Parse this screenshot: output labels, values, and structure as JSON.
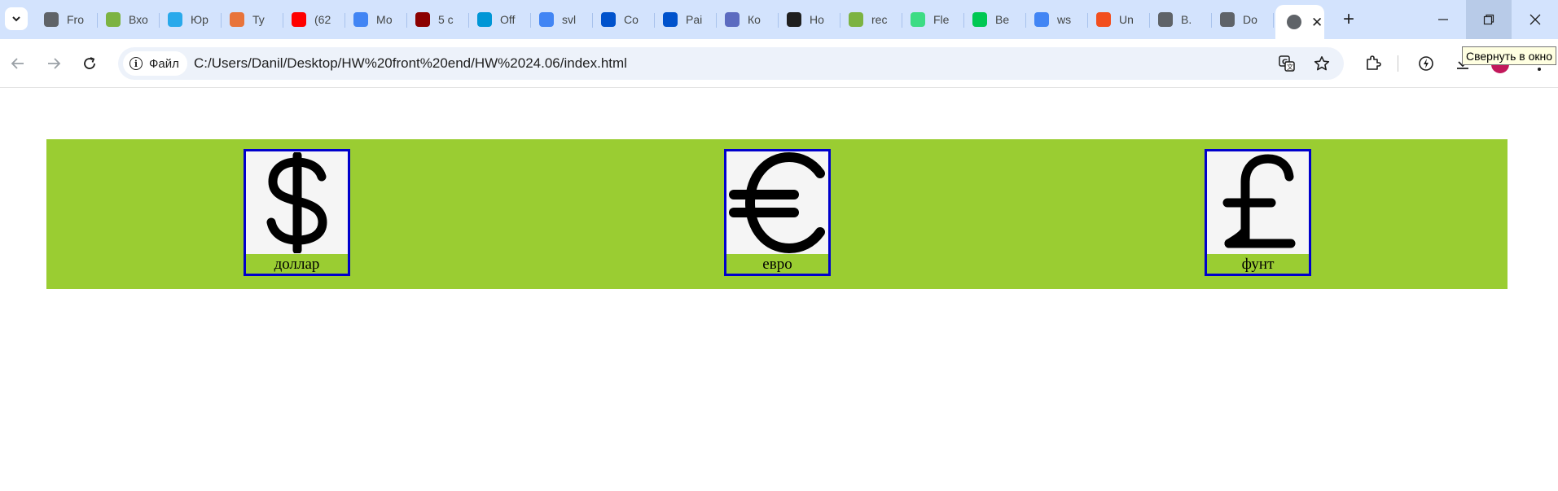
{
  "browser": {
    "tabs": [
      {
        "title": "Fro",
        "favicon": "globe-icon",
        "color": "#5f6368"
      },
      {
        "title": "Вхо",
        "favicon": "mail-icon",
        "color": "#7cb342"
      },
      {
        "title": "Юр",
        "favicon": "telegram-icon",
        "color": "#29a9eb"
      },
      {
        "title": "Ту",
        "favicon": "orange-circle-icon",
        "color": "#e8743b"
      },
      {
        "title": "(62",
        "favicon": "youtube-icon",
        "color": "#ff0000"
      },
      {
        "title": "Мо",
        "favicon": "multicolor-circle-icon",
        "color": "#4285f4"
      },
      {
        "title": "5 с",
        "favicon": "yc-icon",
        "color": "#8b0000"
      },
      {
        "title": "Off",
        "favicon": "hp-icon",
        "color": "#0096d6"
      },
      {
        "title": "svl",
        "favicon": "google-icon",
        "color": "#4285f4"
      },
      {
        "title": "Co",
        "favicon": "blue-squares-icon",
        "color": "#0052cc"
      },
      {
        "title": "Pai",
        "favicon": "blue-squares-icon",
        "color": "#0052cc"
      },
      {
        "title": "Ко",
        "favicon": "grid-icon",
        "color": "#5c6bc0"
      },
      {
        "title": "Ho",
        "favicon": "n-icon",
        "color": "#1f1f1f"
      },
      {
        "title": "rec",
        "favicon": "mail-icon",
        "color": "#7cb342"
      },
      {
        "title": "Fle",
        "favicon": "android-icon",
        "color": "#3ddc84"
      },
      {
        "title": "Be",
        "favicon": "star-icon",
        "color": "#00c853"
      },
      {
        "title": "ws",
        "favicon": "google-icon",
        "color": "#4285f4"
      },
      {
        "title": "Un",
        "favicon": "figma-icon",
        "color": "#f24e1e"
      },
      {
        "title": "В.",
        "favicon": "ich-icon",
        "color": "#5f6368"
      },
      {
        "title": "Do",
        "favicon": "globe-icon",
        "color": "#5f6368"
      }
    ],
    "active_tab_favicon": "globe-icon",
    "new_tab": "+",
    "tooltip": "Свернуть в окно",
    "address": {
      "chip_label": "Файл",
      "url": "C:/Users/Danil/Desktop/HW%20front%20end/HW%2024.06/index.html"
    }
  },
  "page": {
    "currencies": [
      {
        "symbol": "$",
        "label": "доллар"
      },
      {
        "symbol": "€",
        "label": "евро"
      },
      {
        "symbol": "£",
        "label": "фунт"
      }
    ],
    "banner_color": "#9acd32",
    "card_border_color": "#0000cc"
  }
}
